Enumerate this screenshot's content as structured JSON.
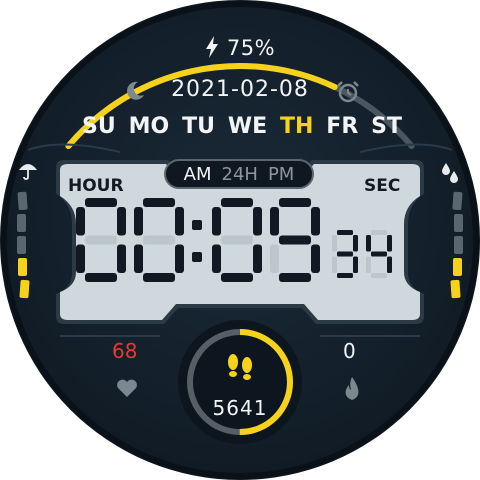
{
  "status": {
    "battery_text": "75%",
    "battery_level": 0.75,
    "date_text": "2021-02-08"
  },
  "weekdays": [
    "SU",
    "MO",
    "TU",
    "WE",
    "TH",
    "FR",
    "ST"
  ],
  "active_weekday": "TH",
  "time_mode": {
    "am": "AM",
    "h24": "24H",
    "pm": "PM",
    "active": "AM"
  },
  "labels": {
    "hour": "HOUR",
    "sec": "SEC"
  },
  "time": {
    "hours": "00",
    "minutes": "09",
    "seconds": "34"
  },
  "health": {
    "heart_rate": "68",
    "calories": "0",
    "steps": "5641",
    "steps_goal_fraction": 0.5
  },
  "icons": {
    "battery": "lightning-bolt-icon",
    "night": "moon-icon",
    "alarm": "alarm-clock-icon",
    "weather": "umbrella-icon",
    "humidity": "water-drops-icon",
    "heart": "heart-icon",
    "calories": "flame-icon",
    "steps": "footsteps-icon"
  },
  "colors": {
    "accent": "#f6d21b",
    "heart_rate": "#e8392e",
    "background": "#131f2a",
    "lcd": "#cfd9dd",
    "text": "#f2f4f5"
  }
}
